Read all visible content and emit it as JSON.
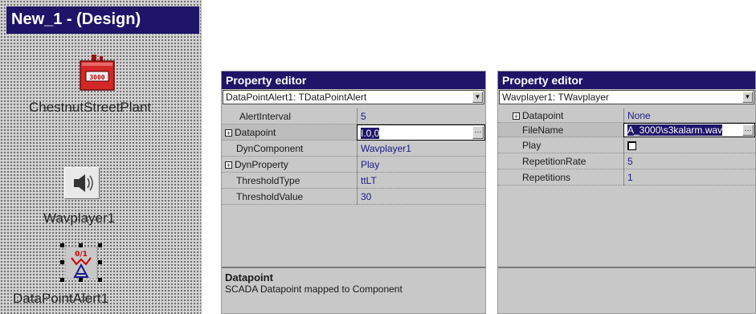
{
  "design": {
    "title": "New_1 - (Design)",
    "components": {
      "plant_label": "ChestnutStreetPlant",
      "plant_counter": "3000",
      "wav_label": "Wavplayer1",
      "alert_label": "DataPointAlert1"
    }
  },
  "editor1": {
    "title": "Property editor",
    "selector": "DataPointAlert1: TDataPointAlert",
    "rows": [
      {
        "name": "AlertInterval",
        "value": "5"
      },
      {
        "name": "Datapoint",
        "value": "I.0,0"
      },
      {
        "name": "DynComponent",
        "value": "Wavplayer1"
      },
      {
        "name": "DynProperty",
        "value": "Play"
      },
      {
        "name": "ThresholdType",
        "value": "ttLT"
      },
      {
        "name": "ThresholdValue",
        "value": "30"
      }
    ],
    "description": {
      "title": "Datapoint",
      "text": "SCADA Datapoint mapped to Component"
    }
  },
  "editor2": {
    "title": "Property editor",
    "selector": "Wavplayer1: TWavplayer",
    "rows": [
      {
        "name": "Datapoint",
        "value": "None"
      },
      {
        "name": "FileName",
        "value": "A_3000\\s3kalarm.wav"
      },
      {
        "name": "Play",
        "value": ""
      },
      {
        "name": "RepetitionRate",
        "value": "5"
      },
      {
        "name": "Repetitions",
        "value": "1"
      }
    ]
  },
  "colors": {
    "titlebar": "#1e1468",
    "value_text": "#1a1a8a",
    "plant_red": "#d42828"
  },
  "icons": {
    "expand": "plus-box-icon",
    "dropdown": "chevron-down-icon",
    "ellipsis": "ellipsis-button-icon",
    "speaker": "speaker-icon",
    "alert": "datapoint-alert-icon",
    "plant": "plant-counter-icon"
  }
}
